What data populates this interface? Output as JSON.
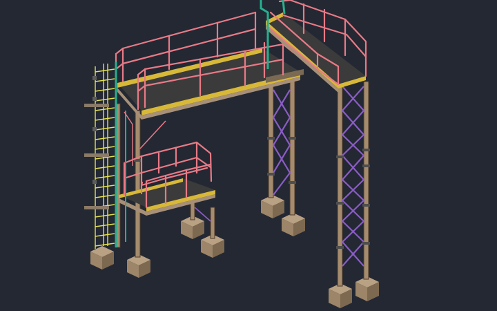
{
  "view": {
    "background": "#232833",
    "subject": "isometric-steel-platform-structure"
  },
  "colors": {
    "handrail": "#e87a86",
    "column": "#a58c6e",
    "bracing": "#8a5cc4",
    "ladder_rungs": "#e5e34a",
    "ladder_stiles": "#25b08f",
    "toe_plate": "#d8b838",
    "deck": "#3b3b3b",
    "foundation": "#b9a184"
  },
  "icons": [
    "platform-deck",
    "handrail",
    "ladder",
    "cross-bracing",
    "column",
    "foundation-pad"
  ]
}
